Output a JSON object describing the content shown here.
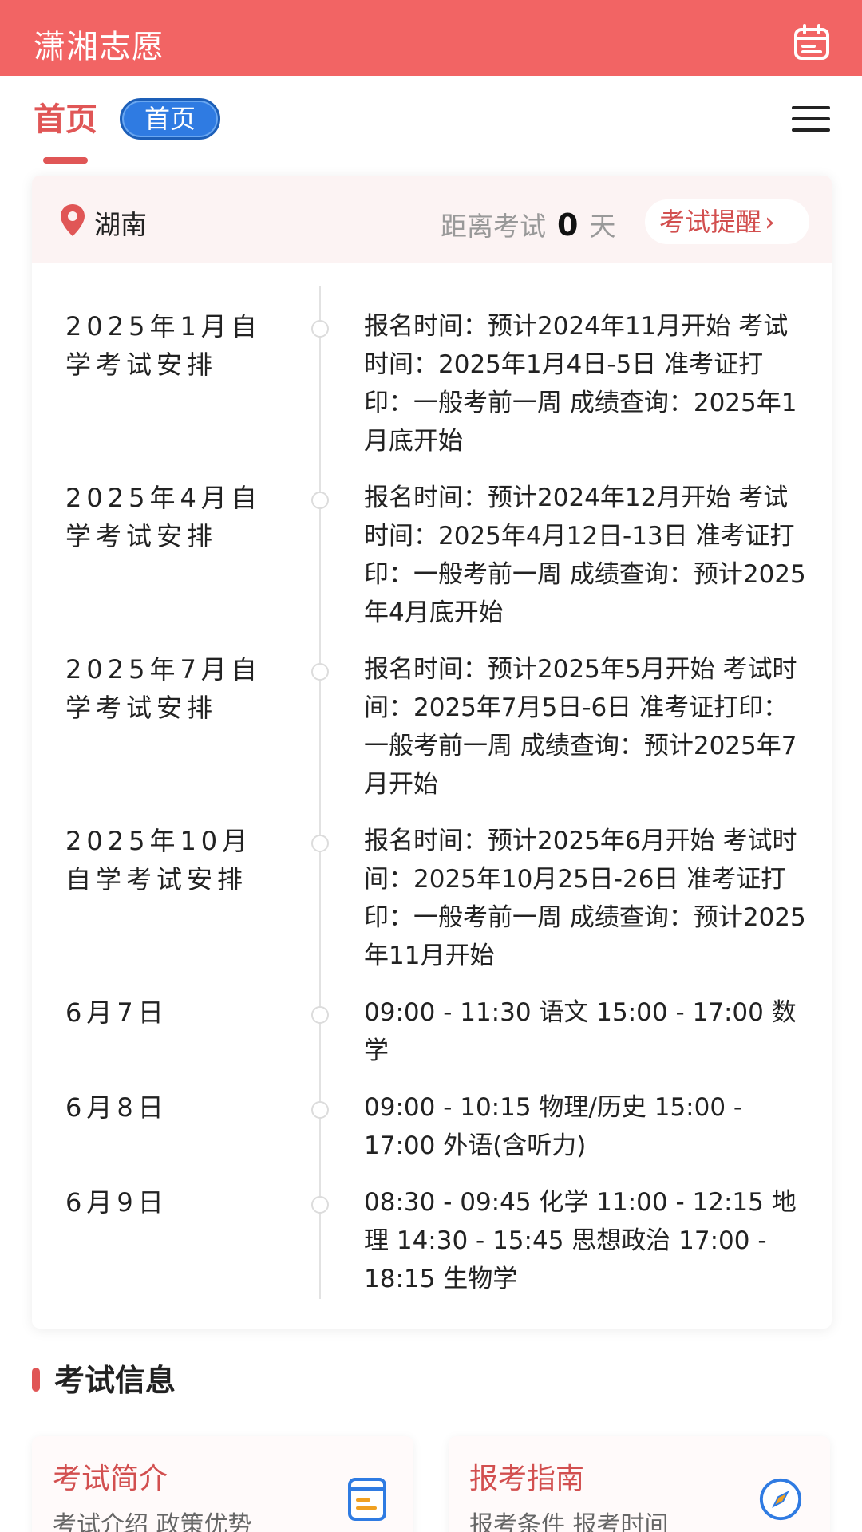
{
  "header": {
    "title": "潇湘志愿",
    "calendar_icon": "calendar-icon"
  },
  "tabs": {
    "active_label": "首页",
    "pill_label": "首页",
    "menu_icon": "hamburger-menu-icon"
  },
  "card": {
    "region": "湖南",
    "countdown_prefix": "距离考试",
    "countdown_days": "0",
    "countdown_suffix": "天",
    "remind_label": "考试提醒",
    "remind_chevron": "›",
    "schedule": [
      {
        "title": "2025年1月自学考试安排",
        "detail": "报名时间：预计2024年11月开始 考试时间：2025年1月4日-5日 准考证打印：一般考前一周 成绩查询：2025年1月底开始"
      },
      {
        "title": "2025年4月自学考试安排",
        "detail": "报名时间：预计2024年12月开始 考试时间：2025年4月12日-13日 准考证打印：一般考前一周 成绩查询：预计2025年4月底开始"
      },
      {
        "title": "2025年7月自学考试安排",
        "detail": "报名时间：预计2025年5月开始 考试时间：2025年7月5日-6日 准考证打印：一般考前一周 成绩查询：预计2025年7月开始"
      },
      {
        "title": "2025年10月自学考试安排",
        "detail": "报名时间：预计2025年6月开始 考试时间：2025年10月25日-26日 准考证打印：一般考前一周 成绩查询：预计2025年11月开始"
      },
      {
        "title": "6月7日",
        "detail": "09:00 - 11:30 语文 15:00 - 17:00 数学"
      },
      {
        "title": "6月8日",
        "detail": "09:00 - 10:15 物理/历史 15:00 - 17:00 外语(含听力)"
      },
      {
        "title": "6月9日",
        "detail": "08:30 - 09:45 化学 11:00 - 12:15 地理 14:30 - 15:45 思想政治 17:00 - 18:15 生物学"
      }
    ]
  },
  "section": {
    "title": "考试信息"
  },
  "info_cards": [
    {
      "title": "考试简介",
      "subtitle": "考试介绍 政策优势",
      "icon": "document-icon"
    },
    {
      "title": "报考指南",
      "subtitle": "报考条件 报考时间",
      "icon": "compass-icon"
    }
  ],
  "colors": {
    "brand": "#f26464",
    "accent_red": "#e05656",
    "pill_blue": "#2f7be2"
  }
}
